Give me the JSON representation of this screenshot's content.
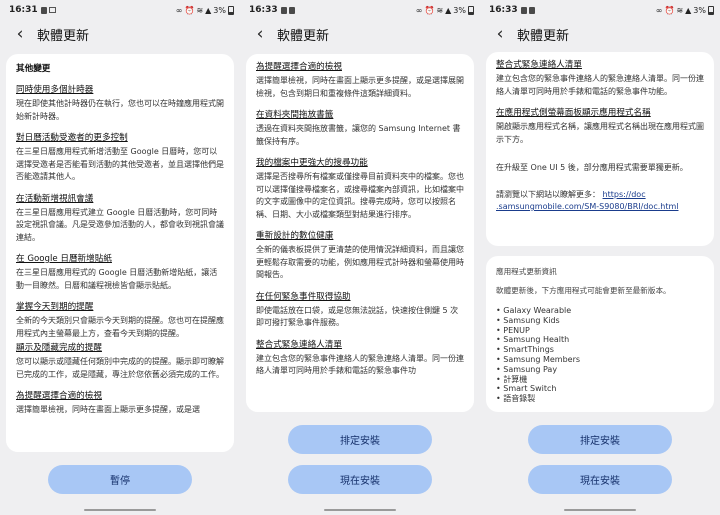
{
  "screens": [
    {
      "status": {
        "time": "16:31",
        "battery": "3%"
      },
      "title": "軟體更新",
      "section_title": "其他變更",
      "items": [
        {
          "title": "同時使用多個計時器",
          "body": "現在即使其他計時器仍在執行，您也可以在時鐘應用程式開始新計時器。"
        },
        {
          "title": "對日曆活動受邀者的更多控制",
          "body": "在三星日曆應用程式新增活動至 Google 日曆時，您可以選擇受邀者是否能看到活動的其他受邀者，並且選擇他們是否能邀請其他人。"
        },
        {
          "title": "在活動新增視訊會議",
          "body": "在三星日曆應用程式建立 Google 日曆活動時，您可同時設定視訊會議。凡是受邀參加活動的人，都會收到視訊會議連結。"
        },
        {
          "title": "在 Google 日曆新增貼紙",
          "body": "在三星日曆應用程式的 Google 日曆活動新增貼紙，讓活動一目瞭然。日曆和議程視檢皆會顯示貼紙。"
        },
        {
          "title": "掌握今天到期的提醒",
          "body": "全新的今天類別只會顯示今天到期的提醒。您也可在提醒應用程式內主螢幕最上方，查看今天到期的提醒。"
        },
        {
          "title": "顯示及隱藏完成的提醒",
          "body": "您可以顯示或隱藏任何類別中完成的的提醒。顯示即可瞭解已完成的工作，或是隱藏，專注於您依舊必須完成的工作。"
        },
        {
          "title": "為提醒選擇合適的檢視",
          "body": "選擇簡單檢視，同時在畫面上顯示更多提醒，或是選"
        }
      ],
      "buttons": [
        "暫停"
      ]
    },
    {
      "status": {
        "time": "16:33",
        "battery": "3%"
      },
      "title": "軟體更新",
      "items": [
        {
          "title": "為提醒選擇合適的檢視",
          "body": "選擇簡單檢視，同時在畫面上顯示更多提醒，或是選擇展開檢視，包含到期日和重複條件這類詳細資料。"
        },
        {
          "title": "在資料夾間拖放書籤",
          "body": "透過在資料夾間拖放書籤，讓您的 Samsung Internet 書籤保持有序。"
        },
        {
          "title": "我的檔案中更強大的搜尋功能",
          "body": "選擇是否搜尋所有檔案或僅搜尋目前資料夾中的檔案。您也可以選擇僅搜尋檔案名，或搜尋檔案內部資訊，比如檔案中的文字或圖像中的定位資訊。搜尋完成時，您可以按照名稱、日期、大小或檔案類型對結果進行排序。"
        },
        {
          "title": "重新設計的數位健康",
          "body": "全新的儀表板提供了更清楚的使用情況詳細資料，而且讓您更輕鬆存取需要的功能，例如應用程式計時器和螢幕使用時間報告。"
        },
        {
          "title": "在任何緊急事件取得協助",
          "body": "即使電話放在口袋，或是您無法說話，快速按住側鍵 5 次即可撥打緊急事件服務。"
        },
        {
          "title": "整合式緊急連絡人清單",
          "body": "建立包含您的緊急事件連絡人的緊急連絡人清單。同一份連絡人清單可同時用於手錶和電話的緊急事件功"
        }
      ],
      "buttons": [
        "排定安裝",
        "現在安裝"
      ]
    },
    {
      "status": {
        "time": "16:33",
        "battery": "3%"
      },
      "title": "軟體更新",
      "items": [
        {
          "title": "整合式緊急連絡人清單",
          "body": "建立包含您的緊急事件連絡人的緊急連絡人清單。同一份連絡人清單可同時用於手錶和電話的緊急事件功能。"
        },
        {
          "title": "在應用程式側螢幕面板顯示應用程式名稱",
          "body": "開啟顯示應用程式名稱，讓應用程式名稱出現在應用程式圖示下方。"
        }
      ],
      "note": "在升級至 One UI 5 後，部分應用程式需要單獨更新。",
      "visit_text": "請瀏覽以下網站以瞭解更多：",
      "visit_link": "https://doc.samsungmobile.com/SM-S9080/BRI/doc.html",
      "visit_link_line1": "https://doc",
      "visit_link_line2": ".samsungmobile.com/SM-S9080/BRI/doc.html",
      "app_card": {
        "heading": "應用程式更新資訊",
        "subtitle": "軟體更新後，下方應用程式可能會更新至最新版本。",
        "apps": [
          "Galaxy Wearable",
          "Samsung Kids",
          "PENUP",
          "Samsung Health",
          "SmartThings",
          "Samsung Members",
          "Samsung Pay",
          "計算機",
          "Smart Switch",
          "語音錄製"
        ]
      },
      "buttons": [
        "排定安裝",
        "現在安裝"
      ]
    }
  ]
}
